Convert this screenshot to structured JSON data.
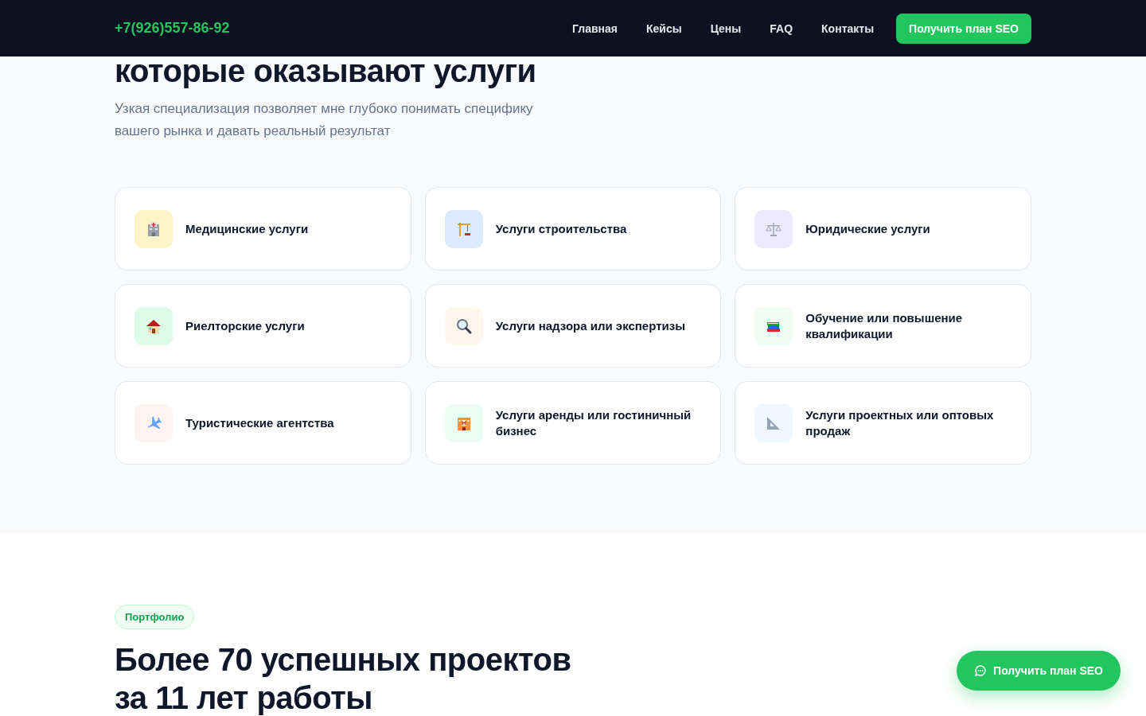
{
  "header": {
    "phone": "+7(926)557-86-92",
    "nav": [
      "Главная",
      "Кейсы",
      "Цены",
      "FAQ",
      "Контакты"
    ],
    "cta": "Получить план SEO"
  },
  "intro": {
    "heading": "которые оказывают услуги",
    "text": "Узкая специализация позволяет мне глубоко понимать специфику вашего рынка и давать реальный результат"
  },
  "services": [
    {
      "label": "Медицинские услуги",
      "kind": "hospital",
      "color": "#fef3c7"
    },
    {
      "label": "Услуги строительства",
      "kind": "crane",
      "color": "#dbeafe"
    },
    {
      "label": "Юридические услуги",
      "kind": "scales",
      "color": "#ede9fe"
    },
    {
      "label": "Риелторские услуги",
      "kind": "house",
      "color": "#dcfce7"
    },
    {
      "label": "Услуги надзора или экспертизы",
      "kind": "magnifier",
      "color": "#fff7ed"
    },
    {
      "label": "Обучение или повышение квалификации",
      "kind": "books",
      "color": "#f0fdf4"
    },
    {
      "label": "Туристические агентства",
      "kind": "plane",
      "color": "#fef2f2"
    },
    {
      "label": "Услуги аренды или гостиничный бизнес",
      "kind": "hotel",
      "color": "#ecfdf5"
    },
    {
      "label": "Услуги проектных или оптовых продаж",
      "kind": "ruler",
      "color": "#eff6ff"
    }
  ],
  "portfolio": {
    "badge": "Портфолио",
    "heading": "Более 70 успешных проектов за 11 лет работы"
  },
  "floating_button": "Получить план SEO"
}
